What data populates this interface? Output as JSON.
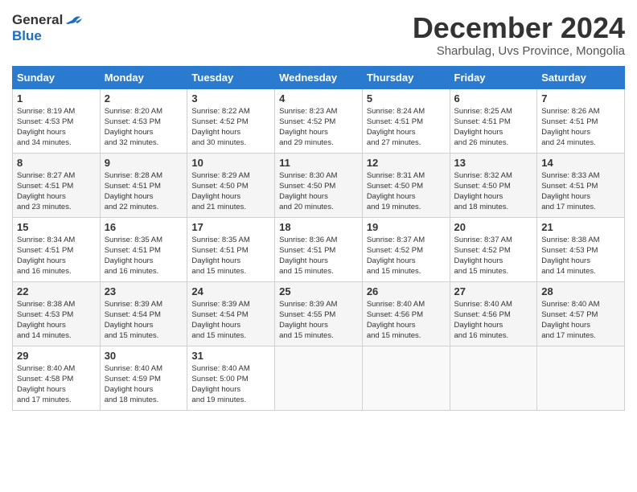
{
  "header": {
    "logo_general": "General",
    "logo_blue": "Blue",
    "month_title": "December 2024",
    "location": "Sharbulag, Uvs Province, Mongolia"
  },
  "days_of_week": [
    "Sunday",
    "Monday",
    "Tuesday",
    "Wednesday",
    "Thursday",
    "Friday",
    "Saturday"
  ],
  "weeks": [
    [
      {
        "day": "1",
        "sunrise": "8:19 AM",
        "sunset": "4:53 PM",
        "daylight": "8 hours and 34 minutes."
      },
      {
        "day": "2",
        "sunrise": "8:20 AM",
        "sunset": "4:53 PM",
        "daylight": "8 hours and 32 minutes."
      },
      {
        "day": "3",
        "sunrise": "8:22 AM",
        "sunset": "4:52 PM",
        "daylight": "8 hours and 30 minutes."
      },
      {
        "day": "4",
        "sunrise": "8:23 AM",
        "sunset": "4:52 PM",
        "daylight": "8 hours and 29 minutes."
      },
      {
        "day": "5",
        "sunrise": "8:24 AM",
        "sunset": "4:51 PM",
        "daylight": "8 hours and 27 minutes."
      },
      {
        "day": "6",
        "sunrise": "8:25 AM",
        "sunset": "4:51 PM",
        "daylight": "8 hours and 26 minutes."
      },
      {
        "day": "7",
        "sunrise": "8:26 AM",
        "sunset": "4:51 PM",
        "daylight": "8 hours and 24 minutes."
      }
    ],
    [
      {
        "day": "8",
        "sunrise": "8:27 AM",
        "sunset": "4:51 PM",
        "daylight": "8 hours and 23 minutes."
      },
      {
        "day": "9",
        "sunrise": "8:28 AM",
        "sunset": "4:51 PM",
        "daylight": "8 hours and 22 minutes."
      },
      {
        "day": "10",
        "sunrise": "8:29 AM",
        "sunset": "4:50 PM",
        "daylight": "8 hours and 21 minutes."
      },
      {
        "day": "11",
        "sunrise": "8:30 AM",
        "sunset": "4:50 PM",
        "daylight": "8 hours and 20 minutes."
      },
      {
        "day": "12",
        "sunrise": "8:31 AM",
        "sunset": "4:50 PM",
        "daylight": "8 hours and 19 minutes."
      },
      {
        "day": "13",
        "sunrise": "8:32 AM",
        "sunset": "4:50 PM",
        "daylight": "8 hours and 18 minutes."
      },
      {
        "day": "14",
        "sunrise": "8:33 AM",
        "sunset": "4:51 PM",
        "daylight": "8 hours and 17 minutes."
      }
    ],
    [
      {
        "day": "15",
        "sunrise": "8:34 AM",
        "sunset": "4:51 PM",
        "daylight": "8 hours and 16 minutes."
      },
      {
        "day": "16",
        "sunrise": "8:35 AM",
        "sunset": "4:51 PM",
        "daylight": "8 hours and 16 minutes."
      },
      {
        "day": "17",
        "sunrise": "8:35 AM",
        "sunset": "4:51 PM",
        "daylight": "8 hours and 15 minutes."
      },
      {
        "day": "18",
        "sunrise": "8:36 AM",
        "sunset": "4:51 PM",
        "daylight": "8 hours and 15 minutes."
      },
      {
        "day": "19",
        "sunrise": "8:37 AM",
        "sunset": "4:52 PM",
        "daylight": "8 hours and 15 minutes."
      },
      {
        "day": "20",
        "sunrise": "8:37 AM",
        "sunset": "4:52 PM",
        "daylight": "8 hours and 15 minutes."
      },
      {
        "day": "21",
        "sunrise": "8:38 AM",
        "sunset": "4:53 PM",
        "daylight": "8 hours and 14 minutes."
      }
    ],
    [
      {
        "day": "22",
        "sunrise": "8:38 AM",
        "sunset": "4:53 PM",
        "daylight": "8 hours and 14 minutes."
      },
      {
        "day": "23",
        "sunrise": "8:39 AM",
        "sunset": "4:54 PM",
        "daylight": "8 hours and 15 minutes."
      },
      {
        "day": "24",
        "sunrise": "8:39 AM",
        "sunset": "4:54 PM",
        "daylight": "8 hours and 15 minutes."
      },
      {
        "day": "25",
        "sunrise": "8:39 AM",
        "sunset": "4:55 PM",
        "daylight": "8 hours and 15 minutes."
      },
      {
        "day": "26",
        "sunrise": "8:40 AM",
        "sunset": "4:56 PM",
        "daylight": "8 hours and 15 minutes."
      },
      {
        "day": "27",
        "sunrise": "8:40 AM",
        "sunset": "4:56 PM",
        "daylight": "8 hours and 16 minutes."
      },
      {
        "day": "28",
        "sunrise": "8:40 AM",
        "sunset": "4:57 PM",
        "daylight": "8 hours and 17 minutes."
      }
    ],
    [
      {
        "day": "29",
        "sunrise": "8:40 AM",
        "sunset": "4:58 PM",
        "daylight": "8 hours and 17 minutes."
      },
      {
        "day": "30",
        "sunrise": "8:40 AM",
        "sunset": "4:59 PM",
        "daylight": "8 hours and 18 minutes."
      },
      {
        "day": "31",
        "sunrise": "8:40 AM",
        "sunset": "5:00 PM",
        "daylight": "8 hours and 19 minutes."
      },
      null,
      null,
      null,
      null
    ]
  ],
  "labels": {
    "sunrise": "Sunrise:",
    "sunset": "Sunset:",
    "daylight": "Daylight:"
  }
}
